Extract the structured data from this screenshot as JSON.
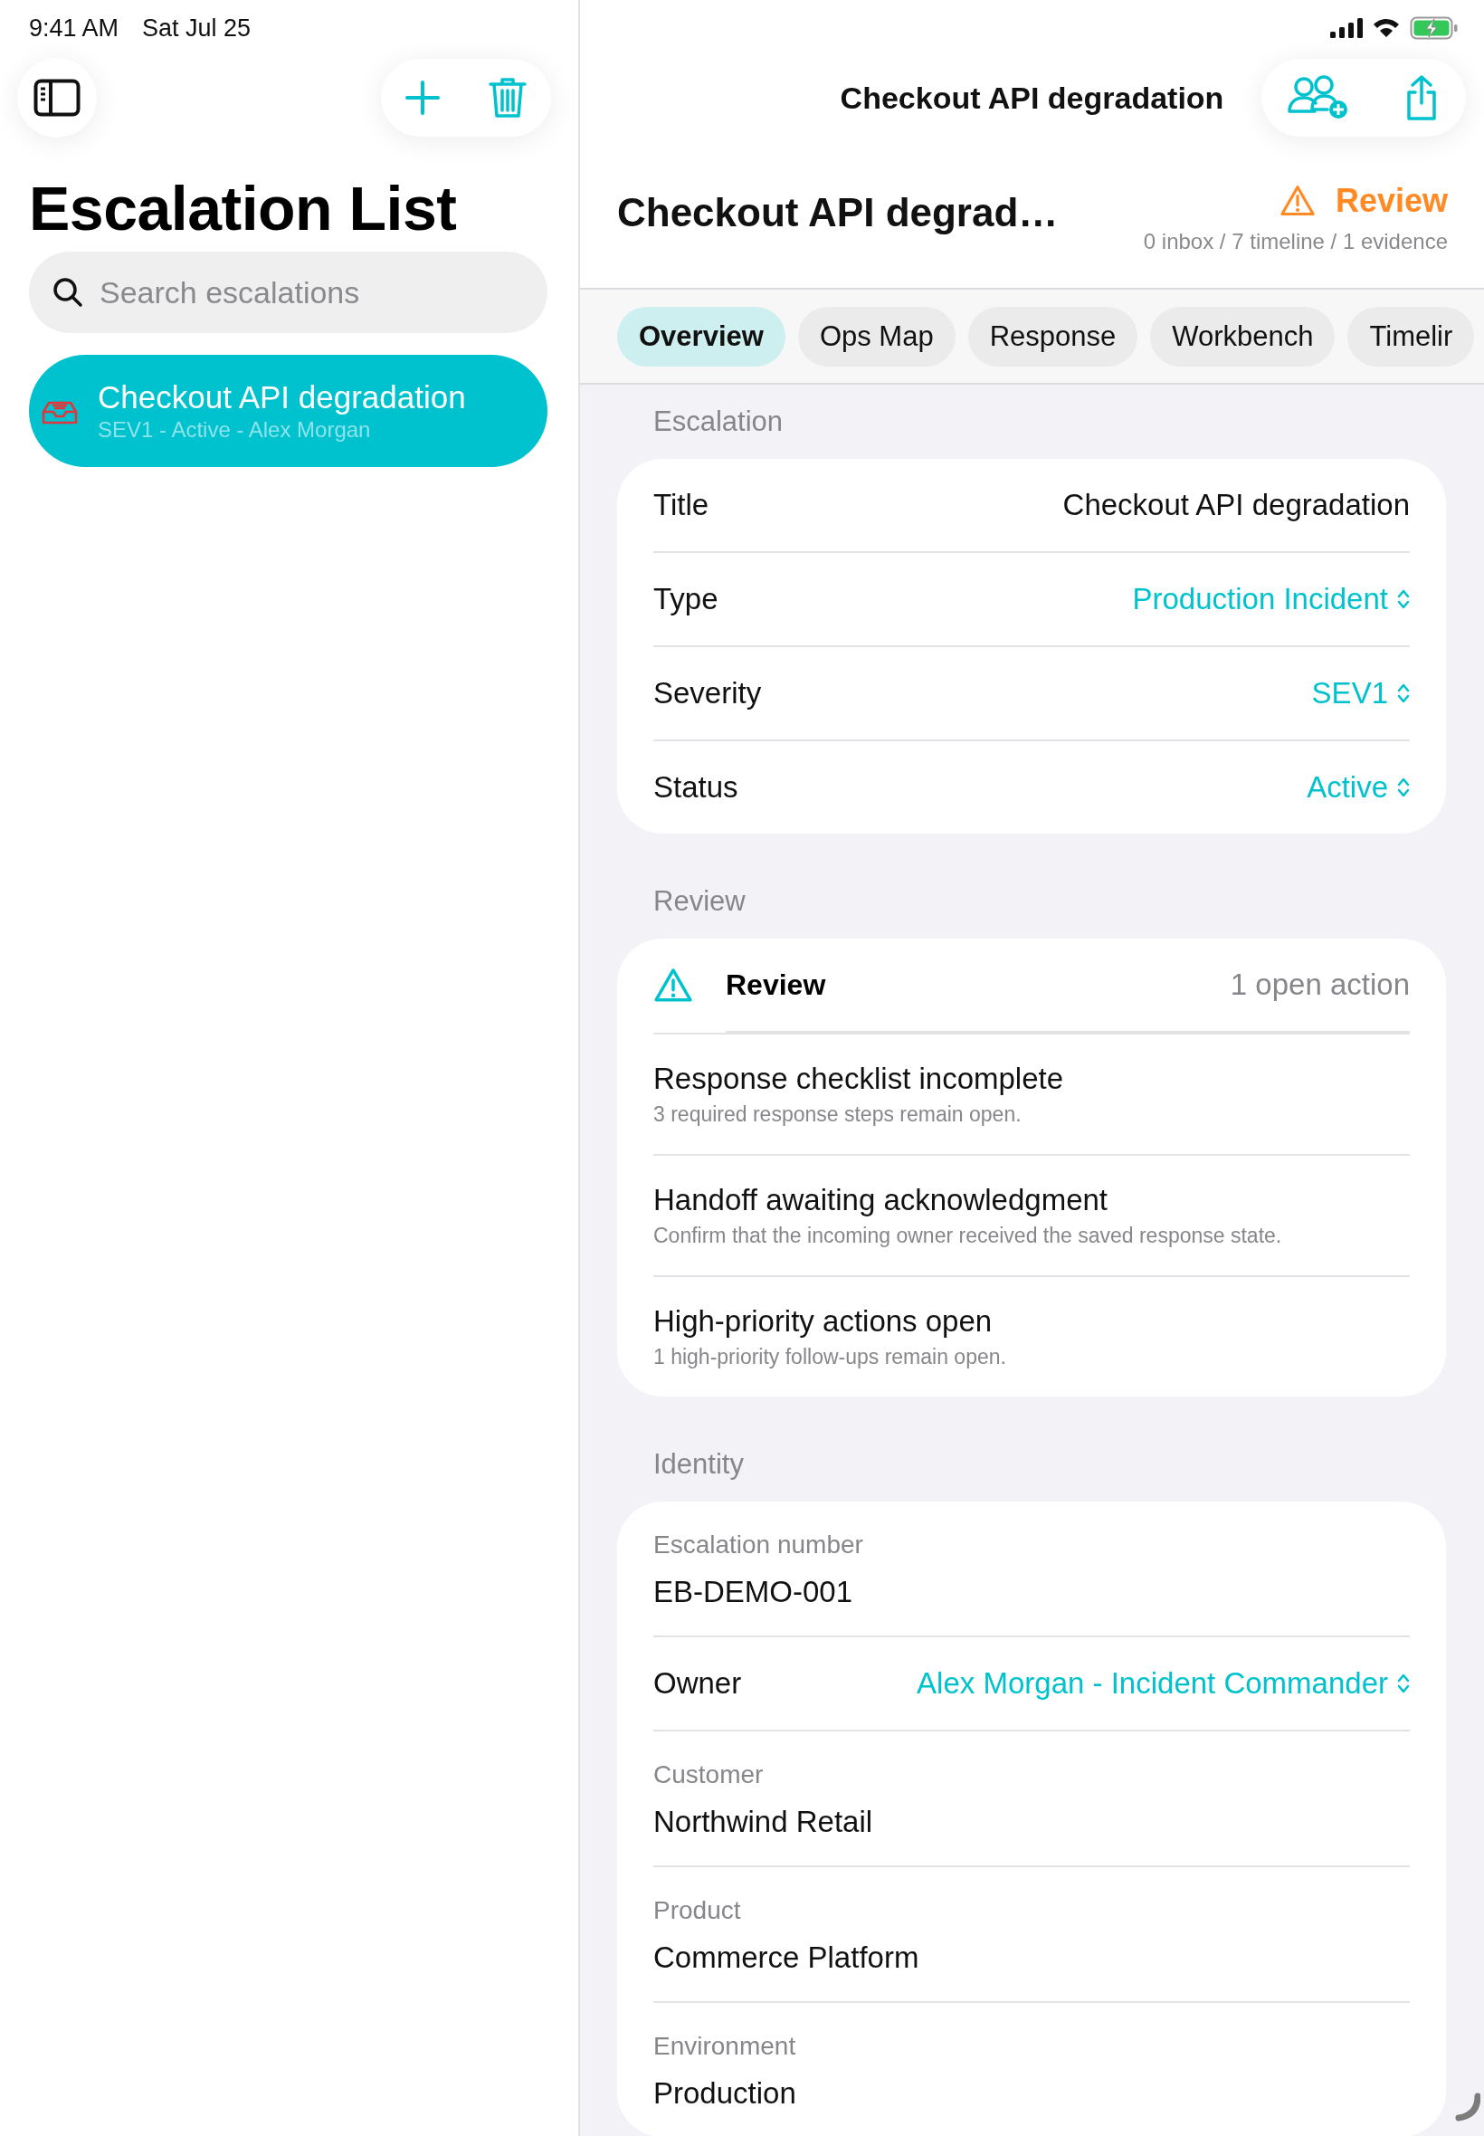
{
  "status_bar": {
    "time": "9:41 AM",
    "date": "Sat Jul 25"
  },
  "sidebar": {
    "title": "Escalation List",
    "search": {
      "placeholder": "Search escalations"
    },
    "items": [
      {
        "title": "Checkout API degradation",
        "subtitle": "SEV1 - Active - Alex Morgan",
        "selected": true
      }
    ]
  },
  "detail": {
    "nav_title": "Checkout API degradation",
    "header": {
      "title": "Checkout API degrad…",
      "badge": "Review",
      "counts": "0 inbox / 7 timeline / 1 evidence"
    },
    "tabs": [
      {
        "label": "Overview",
        "selected": true
      },
      {
        "label": "Ops Map",
        "selected": false
      },
      {
        "label": "Response",
        "selected": false
      },
      {
        "label": "Workbench",
        "selected": false
      },
      {
        "label": "Timelir",
        "selected": false
      }
    ],
    "sections": [
      {
        "kind": "form",
        "header": "Escalation",
        "rows": [
          {
            "kind": "value",
            "label": "Title",
            "value": "Checkout API degradation"
          },
          {
            "kind": "picker",
            "label": "Type",
            "value": "Production Incident"
          },
          {
            "kind": "picker",
            "label": "Severity",
            "value": "SEV1"
          },
          {
            "kind": "picker",
            "label": "Status",
            "value": "Active"
          }
        ]
      },
      {
        "kind": "review",
        "header": "Review",
        "summary": {
          "title": "Review",
          "count": "1 open action"
        },
        "items": [
          {
            "title": "Response checklist incomplete",
            "detail": "3 required response steps remain open."
          },
          {
            "title": "Handoff awaiting acknowledgment",
            "detail": "Confirm that the incoming owner received the saved response state."
          },
          {
            "title": "High-priority actions open",
            "detail": "1 high-priority follow-ups remain open."
          }
        ]
      },
      {
        "kind": "form",
        "header": "Identity",
        "rows": [
          {
            "kind": "stacked",
            "label": "Escalation number",
            "value": "EB-DEMO-001"
          },
          {
            "kind": "picker",
            "label": "Owner",
            "value": "Alex Morgan - Incident Commander"
          },
          {
            "kind": "stacked",
            "label": "Customer",
            "value": "Northwind Retail"
          },
          {
            "kind": "stacked",
            "label": "Product",
            "value": "Commerce Platform"
          },
          {
            "kind": "stacked",
            "label": "Environment",
            "value": "Production"
          }
        ]
      }
    ]
  }
}
